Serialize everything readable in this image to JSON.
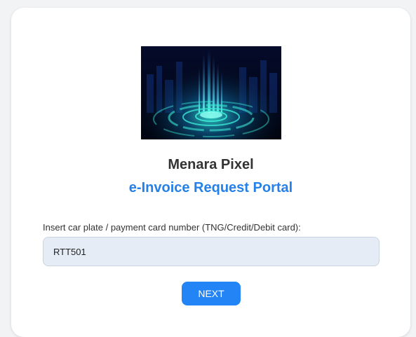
{
  "header": {
    "building_name": "Menara Pixel",
    "portal_title": "e-Invoice Request Portal"
  },
  "hero_image": {
    "icon": "tech-hologram-hero-image"
  },
  "form": {
    "label": "Insert car plate / payment card number (TNG/Credit/Debit card):",
    "value": "RTT501",
    "next_label": "NEXT"
  },
  "colors": {
    "accent": "#2284f5",
    "title_blue": "#2580e8",
    "input_bg": "#e6ecf5"
  }
}
